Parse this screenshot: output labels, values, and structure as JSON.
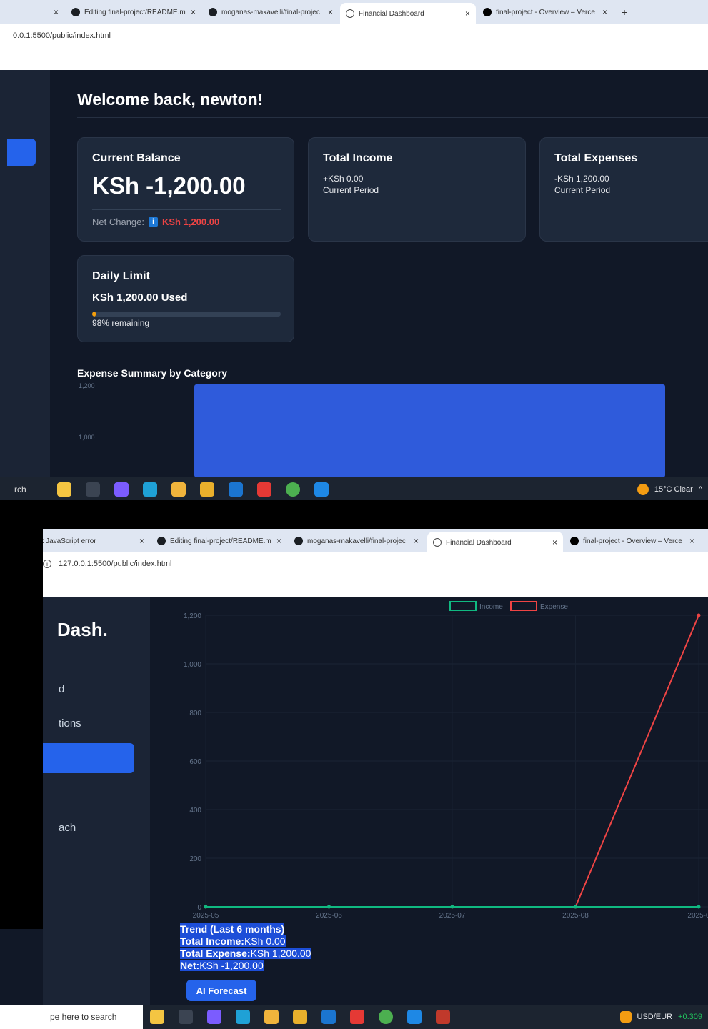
{
  "top": {
    "tabs": [
      {
        "label": "",
        "icon": "close-icon"
      },
      {
        "label": "Editing final-project/README.m",
        "icon": "github-icon"
      },
      {
        "label": "moganas-makavelli/final-projec",
        "icon": "github-icon"
      },
      {
        "label": "Financial Dashboard",
        "icon": "globe-icon"
      },
      {
        "label": "final-project - Overview – Verce",
        "icon": "vercel-icon"
      }
    ],
    "new_tab": "+",
    "address": "0.0.1:5500/public/index.html",
    "welcome": "Welcome back, newton!",
    "balance": {
      "title": "Current Balance",
      "value": "KSh -1,200.00",
      "net_label": "Net Change:",
      "net_icon": "i",
      "net_value": "KSh 1,200.00"
    },
    "income": {
      "title": "Total Income",
      "value": "+KSh 0.00",
      "period": "Current Period"
    },
    "expenses": {
      "title": "Total Expenses",
      "value": "-KSh 1,200.00",
      "period": "Current Period"
    },
    "daily": {
      "title": "Daily Limit",
      "used": "KSh 1,200.00 Used",
      "remaining": "98% remaining",
      "used_fraction": 0.02
    },
    "expense_title": "Expense Summary by Category",
    "taskbar": {
      "search": "rch",
      "weather": "15°C  Clear"
    }
  },
  "bottom": {
    "tabs": [
      {
        "label": "Fix JavaScript error",
        "icon": "none"
      },
      {
        "label": "Editing final-project/README.m",
        "icon": "github-icon"
      },
      {
        "label": "moganas-makavelli/final-projec",
        "icon": "github-icon"
      },
      {
        "label": "Financial Dashboard",
        "icon": "globe-icon"
      },
      {
        "label": "final-project - Overview – Verce",
        "icon": "vercel-icon"
      }
    ],
    "address": "127.0.0.1:5500/public/index.html",
    "brand": "Dash.",
    "nav": [
      "d",
      "tions",
      "",
      "ach"
    ],
    "trend": {
      "heading": "Trend (Last 6 months)",
      "income_label": "Total Income:",
      "income_value": "KSh 0.00",
      "expense_label": "Total Expense:",
      "expense_value": "KSh 1,200.00",
      "net_label": "Net:",
      "net_value": "KSh -1,200.00"
    },
    "ai_button": "AI Forecast",
    "taskbar": {
      "search": "pe here to search",
      "ticker": "USD/EUR",
      "ticker_change": "+0.309"
    }
  },
  "colors": {
    "accent": "#2563eb",
    "income": "#10b981",
    "expense": "#ef4444",
    "warning": "#f59e0b"
  },
  "chart_data": [
    {
      "type": "bar",
      "title": "Expense Summary by Category",
      "categories": [
        ""
      ],
      "values": [
        1200
      ],
      "ylim": [
        0,
        1200
      ],
      "yticks": [
        "1,200",
        "1,000"
      ]
    },
    {
      "type": "line",
      "title": "",
      "x": [
        "2025-05",
        "2025-06",
        "2025-07",
        "2025-08",
        "2025-0"
      ],
      "series": [
        {
          "name": "Income",
          "color": "#10b981",
          "values": [
            0,
            0,
            0,
            0,
            0
          ]
        },
        {
          "name": "Expense",
          "color": "#ef4444",
          "values": [
            0,
            0,
            0,
            0,
            1200
          ]
        }
      ],
      "ylim": [
        0,
        1200
      ],
      "yticks": [
        "0",
        "200",
        "400",
        "600",
        "800",
        "1,000",
        "1,200"
      ],
      "legend": "top"
    }
  ]
}
